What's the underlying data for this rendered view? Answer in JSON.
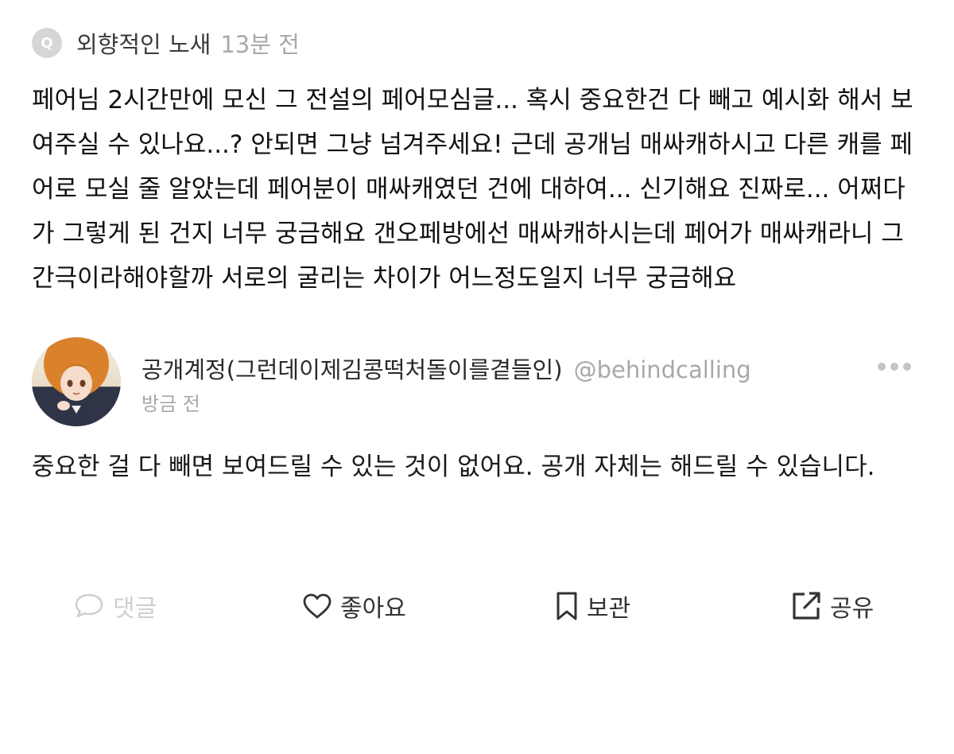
{
  "question": {
    "badge": "Q",
    "asker_name": "외향적인 노새",
    "time": "13분 전",
    "text": "페어님 2시간만에 모신 그 전설의 페어모심글... 혹시 중요한건 다 빼고 예시화 해서 보여주실 수 있나요...? 안되면 그냥 넘겨주세요! 근데 공개님 매싸캐하시고 다른 캐를 페어로 모실 줄 알았는데 페어분이 매싸캐였던 건에 대하여... 신기해요 진짜로... 어쩌다가 그렇게 된 건지 너무 궁금해요 갠오페방에선 매싸캐하시는데 페어가 매싸캐라니 그 간극이라해야할까 서로의 굴리는 차이가 어느정도일지 너무 궁금해요"
  },
  "answer": {
    "answerer_name": "공개계정(그런데이제김콩떡처돌이를곁들인)",
    "answerer_handle": "@behindcalling",
    "time": "방금 전",
    "text": "중요한 걸 다 빼면 보여드릴 수 있는 것이 없어요. 공개 자체는 해드릴 수 있습니다."
  },
  "actions": {
    "comment_label": "댓글",
    "like_label": "좋아요",
    "save_label": "보관",
    "share_label": "공유"
  },
  "icons": {
    "badge": "question-badge-icon",
    "more": "more-dots-icon",
    "comment": "speech-bubble-icon",
    "like": "heart-icon",
    "save": "bookmark-icon",
    "share": "share-arrow-icon"
  },
  "colors": {
    "badge_bg": "#d6d6d6",
    "muted_text": "#a8a8a8",
    "disabled_action": "#cfcfcf",
    "primary_text": "#111111"
  }
}
